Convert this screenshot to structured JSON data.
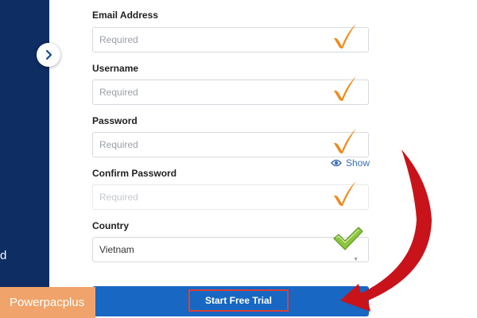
{
  "sidebar": {
    "partial_text": "d"
  },
  "form": {
    "email": {
      "label": "Email Address",
      "placeholder": "Required"
    },
    "username": {
      "label": "Username",
      "placeholder": "Required"
    },
    "password": {
      "label": "Password",
      "placeholder": "Required",
      "show_label": "Show"
    },
    "confirm_password": {
      "label": "Confirm Password",
      "placeholder": "Required"
    },
    "country": {
      "label": "Country",
      "value": "Vietnam"
    }
  },
  "submit": {
    "label": "Start Free Trial"
  },
  "watermark": {
    "text": "Powerpacplus"
  },
  "icons": {
    "collapse": "chevron-right-icon",
    "check_orange": "checkmark-icon",
    "check_green": "checkmark-icon",
    "show": "eye-icon",
    "arrow": "red-arrow-icon"
  },
  "colors": {
    "sidebar": "#0d2d63",
    "check_orange": "#f08a1c",
    "check_green": "#8cc63e",
    "submit_bg": "#1767c3",
    "highlight_border": "#d9403a",
    "arrow": "#c8131a",
    "watermark_bg": "#f0a36a"
  }
}
